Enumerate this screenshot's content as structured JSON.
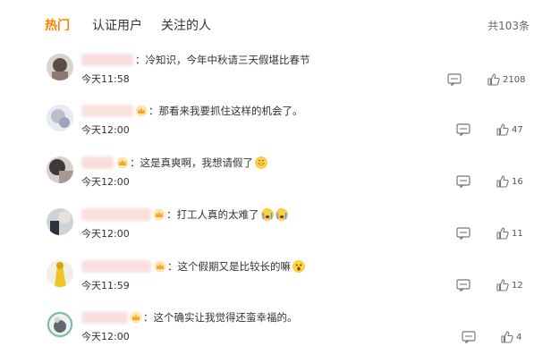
{
  "tabs": [
    {
      "label": "热门",
      "active": true
    },
    {
      "label": "认证用户",
      "active": false
    },
    {
      "label": "关注的人",
      "active": false
    }
  ],
  "total": "共103条",
  "accent_color": "#ff8200",
  "comments": [
    {
      "text": "：冷知识，今年中秋请三天假堪比春节",
      "time": "今天11:58",
      "likes": "2108",
      "has_crown": false,
      "emojis": []
    },
    {
      "text": "：那看来我要抓住这样的机会了。",
      "time": "今天12:00",
      "likes": "47",
      "has_crown": true,
      "emojis": []
    },
    {
      "text": "：这是真爽啊，我想请假了",
      "time": "今天12:00",
      "likes": "16",
      "has_crown": true,
      "emojis": [
        "grin-emoji"
      ]
    },
    {
      "text": "：打工人真的太难了",
      "time": "今天12:00",
      "likes": "11",
      "has_crown": true,
      "emojis": [
        "crying-emoji",
        "crying-emoji"
      ]
    },
    {
      "text": "：这个假期又是比较长的嘛",
      "time": "今天11:59",
      "likes": "12",
      "has_crown": true,
      "emojis": [
        "surprised-emoji"
      ]
    },
    {
      "text": "：这个确实让我觉得还蛮幸福的。",
      "time": "今天12:00",
      "likes": "4",
      "has_crown": true,
      "emojis": []
    }
  ]
}
